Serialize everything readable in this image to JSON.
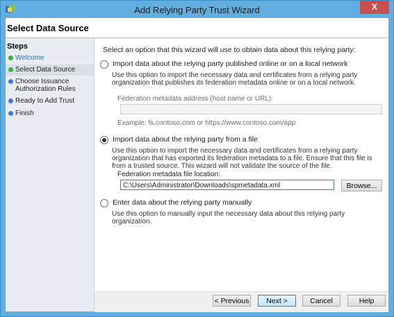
{
  "window": {
    "title": "Add Relying Party Trust Wizard",
    "close_glyph": "X"
  },
  "header": {
    "title": "Select Data Source"
  },
  "steps": {
    "title": "Steps",
    "items": [
      {
        "label": "Welcome",
        "status": "done"
      },
      {
        "label": "Select Data Source",
        "status": "current"
      },
      {
        "label": "Choose Issuance Authorization Rules",
        "status": "pending"
      },
      {
        "label": "Ready to Add Trust",
        "status": "pending"
      },
      {
        "label": "Finish",
        "status": "pending"
      }
    ]
  },
  "content": {
    "intro": "Select an option that this wizard will use to obtain data about this relying party:",
    "option_online": {
      "label": "Import data about the relying party published online or on a local network",
      "desc": "Use this option to import the necessary data and certificates from a relying party organization that publishes its federation metadata online or on a local network.",
      "field_label": "Federation metadata address (host name or URL):",
      "field_value": "",
      "example": "Example: fs.contoso.com or https://www.contoso.com/app"
    },
    "option_file": {
      "label": "Import data about the relying party from a file",
      "desc": "Use this option to import the necessary data and certificates from a relying party organization that has exported its federation metadata to a file. Ensure that this file is from a trusted source.  This wizard will not validate the source of the file.",
      "field_label": "Federation metadata file location:",
      "field_value": "C:\\Users\\Administrator\\Downloads\\spmetadata.xml",
      "browse_label": "Browse..."
    },
    "option_manual": {
      "label": "Enter data about the relying party manually",
      "desc": "Use this option to manually input the necessary data about this relying party organization."
    }
  },
  "footer": {
    "previous": "< Previous",
    "next": "Next >",
    "cancel": "Cancel",
    "help": "Help"
  },
  "colors": {
    "title_bar": "#62aee0",
    "close_button": "#c7504f",
    "step_done": "#3cb043",
    "step_pending": "#3d7bd9",
    "link_text": "#1f6fbf"
  }
}
